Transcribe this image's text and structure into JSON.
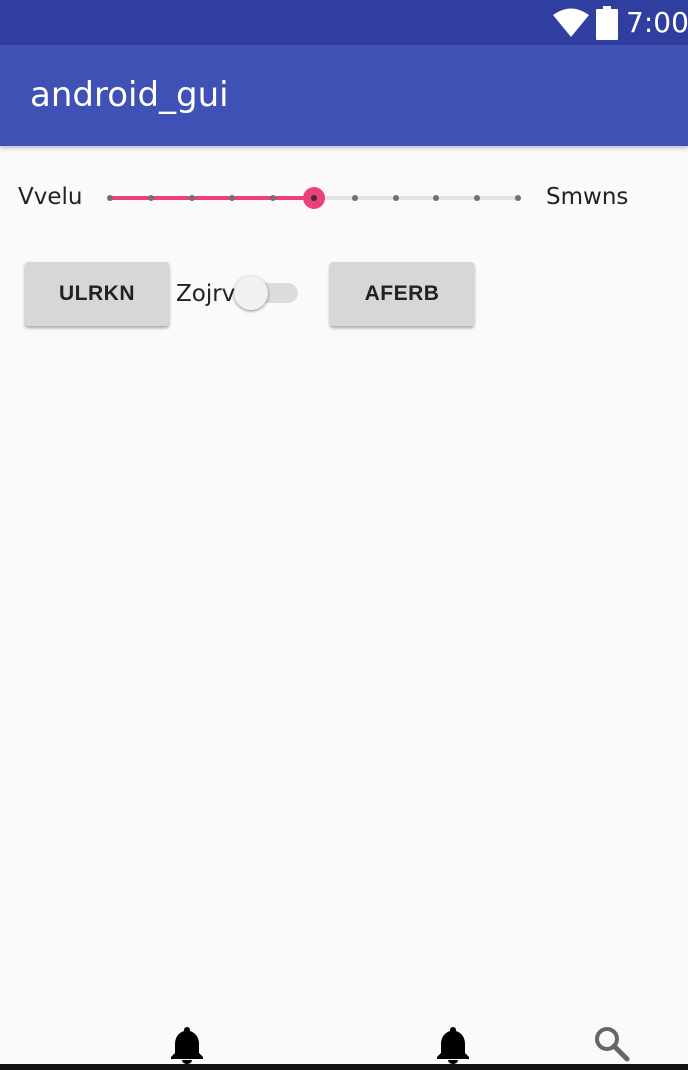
{
  "status_bar": {
    "time": "7:00",
    "icons": [
      "wifi-icon",
      "battery-icon"
    ]
  },
  "app_bar": {
    "title": "android_gui"
  },
  "slider": {
    "left_label": "Vvelu",
    "right_label": "Smwns",
    "min": 0,
    "max": 10,
    "value": 5,
    "accent": "#ec407a"
  },
  "row": {
    "button1_label": "ULRKN",
    "switch_label": "Zojrv",
    "switch_on": false,
    "button2_label": "AFERB"
  },
  "bottom_nav": {
    "icons": [
      "bell-icon",
      "bell-icon",
      "search-icon"
    ]
  },
  "colors": {
    "status_bar": "#303f9f",
    "app_bar": "#3f51b5",
    "background": "#fafafa",
    "button": "#d6d7d7"
  }
}
